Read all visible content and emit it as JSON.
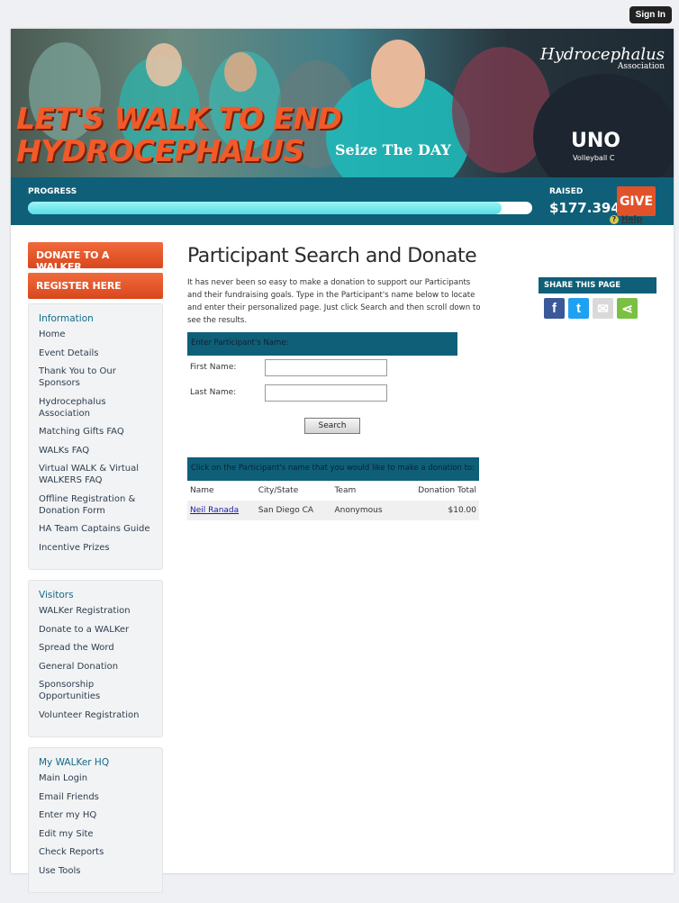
{
  "header": {
    "signin_label": "Sign In"
  },
  "banner": {
    "headline_line1": "LET'S WALK TO END",
    "headline_line2": "HYDROCEPHALUS",
    "logo_name": "Hydrocephalus",
    "logo_sub": "Association",
    "shirt_text": "Seize The DAY",
    "shirt_text2": "UNO",
    "shirt_text3": "Volleyball C"
  },
  "progress": {
    "label": "PROGRESS",
    "percent": 94,
    "raised_label": "RAISED",
    "raised_value": "$177.394",
    "give_label": "GIVE"
  },
  "sidebar": {
    "donate_button": "DONATE TO A WALKER",
    "register_button": "REGISTER HERE",
    "sections": [
      {
        "title": "Information",
        "items": [
          "Home",
          "Event Details",
          "Thank You to Our Sponsors",
          "Hydrocephalus Association",
          "Matching Gifts FAQ",
          "WALKs FAQ",
          "Virtual WALK & Virtual WALKERS FAQ",
          "Offline Registration & Donation Form",
          "HA Team Captains Guide",
          "Incentive Prizes"
        ]
      },
      {
        "title": "Visitors",
        "items": [
          "WALKer Registration",
          "Donate to a WALKer",
          "Spread the Word",
          "General Donation",
          "Sponsorship Opportunities",
          "Volunteer Registration"
        ]
      },
      {
        "title": "My WALKer HQ",
        "items": [
          "Main Login",
          "Email Friends",
          "Enter my HQ",
          "Edit my Site",
          "Check Reports",
          "Use Tools"
        ]
      }
    ]
  },
  "main": {
    "title": "Participant Search and Donate",
    "intro": "It has never been so easy to make a donation to support our Participants and their fundraising goals. Type in the Participant's name below to locate and enter their personalized page. Just click Search and then scroll down to see the results.",
    "help_label": "Help"
  },
  "search": {
    "header": "Enter Participant's Name:",
    "first_name_label": "First Name:",
    "last_name_label": "Last Name:",
    "first_name_value": "",
    "last_name_value": "",
    "button_label": "Search"
  },
  "results": {
    "header": "Click on the Participant's name that you would like to make a donation to:",
    "columns": [
      "Name",
      "City/State",
      "Team",
      "Donation Total"
    ],
    "rows": [
      [
        "Neil Ranada",
        "San Diego CA",
        "Anonymous",
        "$10.00"
      ]
    ]
  },
  "share": {
    "header": "SHARE THIS PAGE",
    "icons": [
      {
        "name": "facebook-icon",
        "color": "#3b5998",
        "glyph": "f"
      },
      {
        "name": "twitter-icon",
        "color": "#1da1f2",
        "glyph": "t"
      },
      {
        "name": "email-icon",
        "color": "#d9d9d9",
        "glyph": "✉"
      },
      {
        "name": "share-icon",
        "color": "#7ac143",
        "glyph": "⋖"
      }
    ]
  }
}
